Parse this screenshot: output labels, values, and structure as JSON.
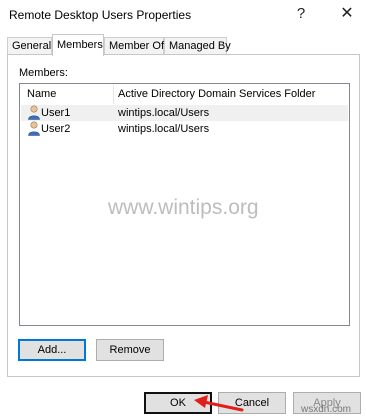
{
  "window": {
    "title": "Remote Desktop Users Properties",
    "help_glyph": "?",
    "close_glyph": "✕"
  },
  "tabs": [
    {
      "label": "General",
      "active": false
    },
    {
      "label": "Members",
      "active": true
    },
    {
      "label": "Member Of",
      "active": false
    },
    {
      "label": "Managed By",
      "active": false
    }
  ],
  "members": {
    "label": "Members:",
    "columns": [
      "Name",
      "Active Directory Domain Services Folder"
    ],
    "rows": [
      {
        "name": "User1",
        "folder": "wintips.local/Users",
        "icon": "user-icon"
      },
      {
        "name": "User2",
        "folder": "wintips.local/Users",
        "icon": "user-icon"
      }
    ]
  },
  "actions": {
    "add": "Add...",
    "remove": "Remove"
  },
  "dialog_buttons": {
    "ok": "OK",
    "cancel": "Cancel",
    "apply": "Apply"
  },
  "watermark": "www.wintips.org",
  "footer_watermark": "wsxdn.com",
  "colors": {
    "accent": "#0078d7",
    "arrow": "#e0201b"
  }
}
